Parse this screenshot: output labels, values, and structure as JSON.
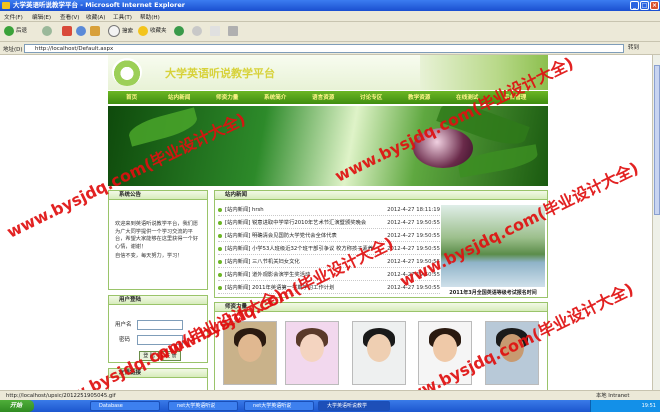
{
  "window": {
    "title": "大学英语听说教学平台 - Microsoft Internet Explorer",
    "minimize_label": "_",
    "maximize_label": "□",
    "close_label": "×"
  },
  "menu": [
    "文件(F)",
    "编辑(E)",
    "查看(V)",
    "收藏(A)",
    "工具(T)",
    "帮助(H)"
  ],
  "toolbar": {
    "back_label": "后退",
    "search_label": "搜索",
    "favorites_label": "收藏夹"
  },
  "address": {
    "label": "地址(D)",
    "url": "http://localhost/Default.aspx",
    "go_label": "转到"
  },
  "site": {
    "title": "大学英语听说教学平台",
    "nav": [
      "首页",
      "站内新闻",
      "师资力量",
      "系统简介",
      "语言资源",
      "讨论专区",
      "教学资源",
      "在线测试",
      "后台管理"
    ],
    "notice": {
      "heading": "系统公告",
      "body_1": "欢迎来到英语听说教学平台，我们愿为广大同学提供一个学习交流的平台，希望大家能够在这里获得一个好心情，谢谢！",
      "body_2": "自信不变，每天努力，学习！"
    },
    "login": {
      "heading": "用户登陆",
      "username_label": "用户名",
      "password_label": "密码",
      "login_button": "登 陆",
      "reset_button": "注 册"
    },
    "links": {
      "heading": "友情链接"
    },
    "news": {
      "heading": "站内新闻",
      "items": [
        {
          "title": "[站内新闻] hrsh",
          "date": "2012-4-27 18:11:19"
        },
        {
          "title": "[站内新闻] 锐意进取中学举行2010年艺术节汇演暨颁奖晚会",
          "date": "2012-4-27 19:50:55"
        },
        {
          "title": "[站内新闻] 明确清会见国防大学党代会全体代表",
          "date": "2012-4-27 19:50:55"
        },
        {
          "title": "[站内新闻] 小学53人班级近32个班干部引争议 校方称孩子素养",
          "date": "2012-4-27 19:50:55"
        },
        {
          "title": "[站内新闻] 三八节机关妇女文化",
          "date": "2012-4-27 19:50:55"
        },
        {
          "title": "[站内新闻] 道外观影会演学生奖活动",
          "date": "2012-4-27 19:50:55"
        },
        {
          "title": "[站内新闻] 2011年英语第一学期学习工作计划",
          "date": "2012-4-27 19:50:55"
        }
      ],
      "photo_caption": "2011年3月全国英语等级考试报名时间"
    },
    "teachers": {
      "heading": "师资力量"
    }
  },
  "status": {
    "text": "http://localhost/upsic/2012251905045.gif",
    "zone": "本地 Intranet"
  },
  "taskbar": {
    "start": "开始",
    "tasks": [
      "Database",
      "net大学英语听说",
      "net大学英语听说",
      "大学英语听说教学"
    ],
    "clock": "19:51"
  },
  "watermark": {
    "text": "www.bysjdq.com(毕业设计大全)"
  },
  "colors": {
    "nav_green": "#4a9a18",
    "nav_text": "#fff58a",
    "panel_border": "#9ac46a",
    "watermark_red": "#e01010",
    "xp_blue": "#1c56cf"
  }
}
